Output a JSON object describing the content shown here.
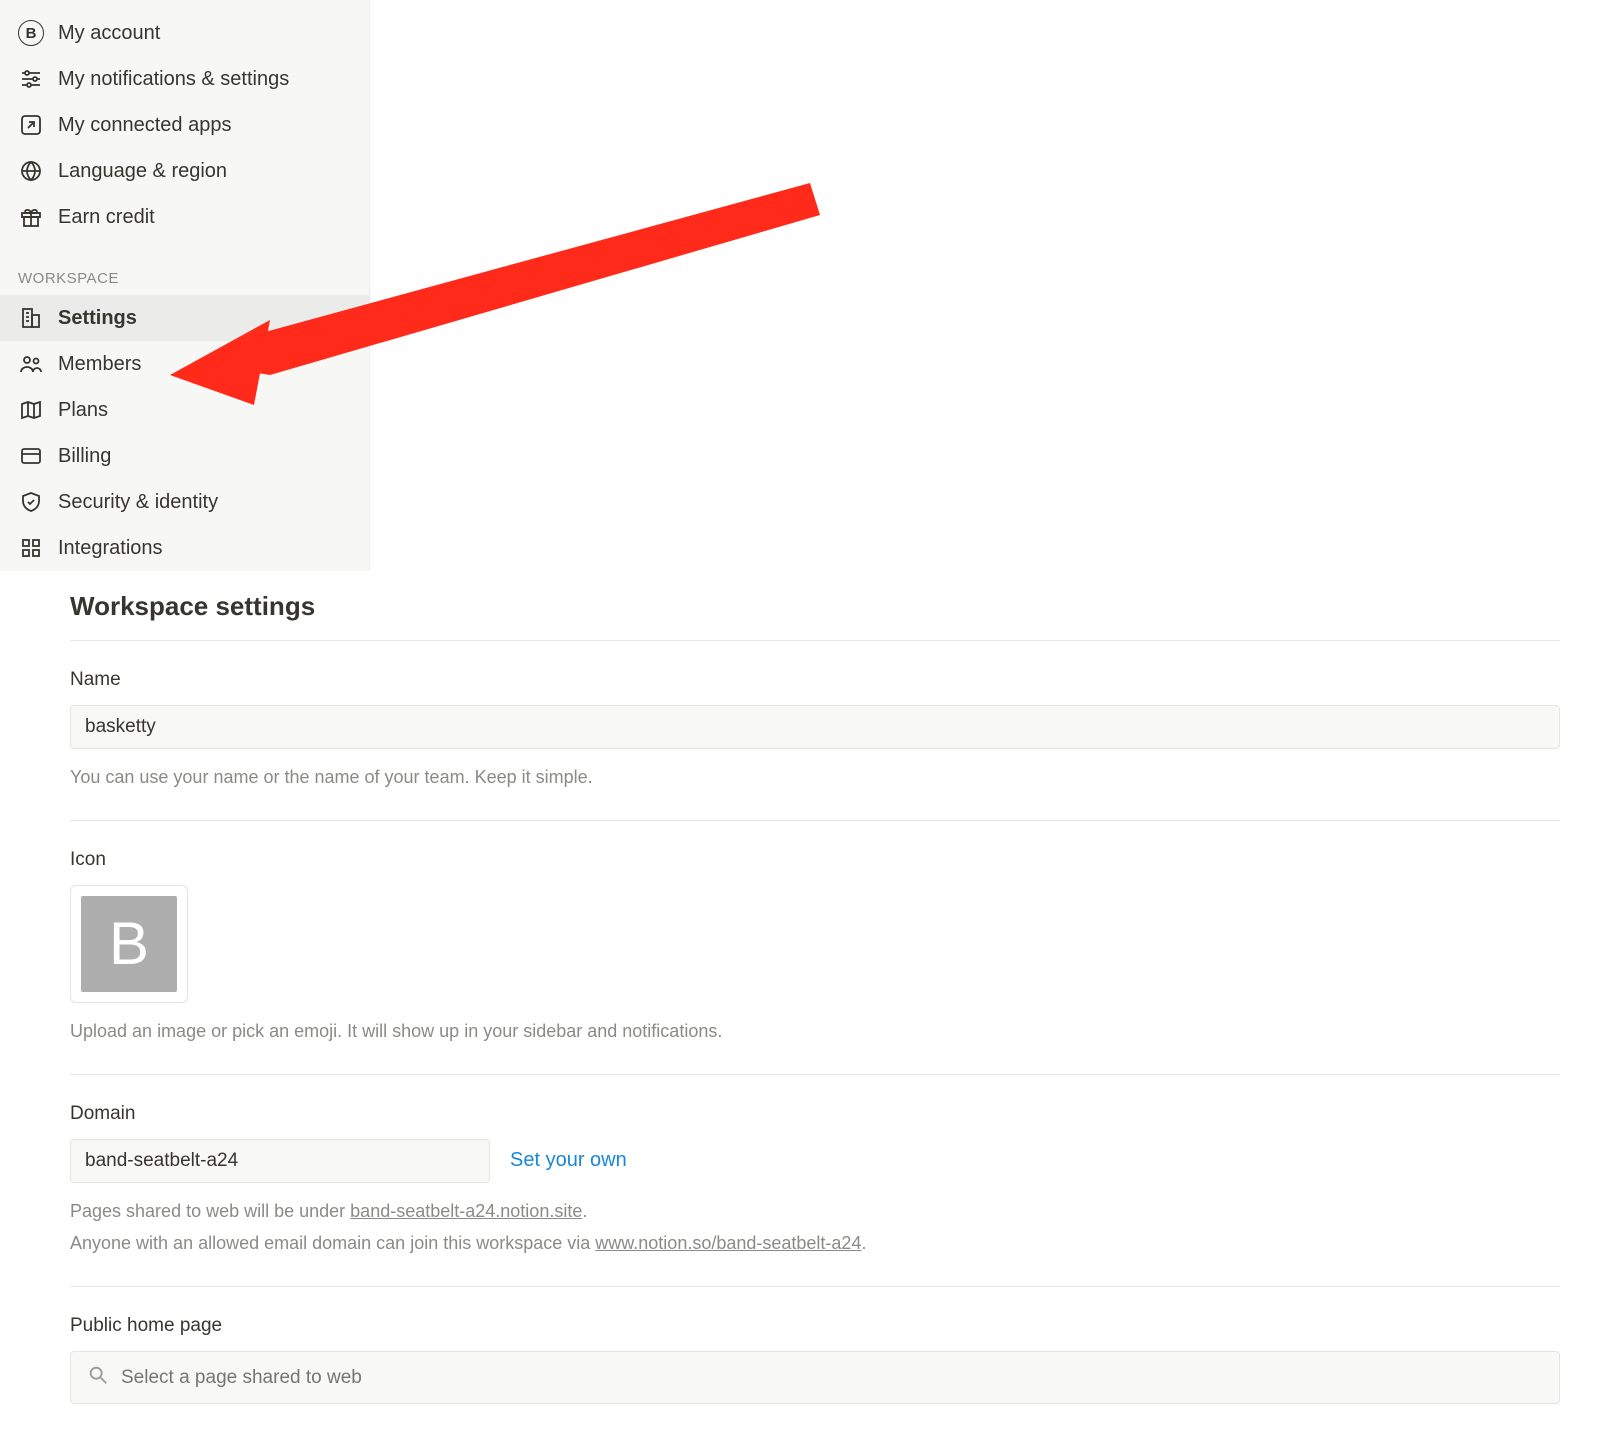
{
  "sidebar": {
    "account": [
      {
        "label": "My account",
        "icon": "circle-b"
      },
      {
        "label": "My notifications & settings",
        "icon": "sliders"
      },
      {
        "label": "My connected apps",
        "icon": "arrow-out"
      },
      {
        "label": "Language & region",
        "icon": "globe"
      },
      {
        "label": "Earn credit",
        "icon": "gift"
      }
    ],
    "workspace_label": "WORKSPACE",
    "workspace": [
      {
        "label": "Settings",
        "icon": "building",
        "selected": true
      },
      {
        "label": "Members",
        "icon": "people"
      },
      {
        "label": "Plans",
        "icon": "map"
      },
      {
        "label": "Billing",
        "icon": "card"
      },
      {
        "label": "Security & identity",
        "icon": "shield"
      },
      {
        "label": "Integrations",
        "icon": "grid"
      }
    ]
  },
  "page": {
    "title": "Workspace settings",
    "name": {
      "label": "Name",
      "value": "basketty",
      "helper": "You can use your name or the name of your team. Keep it simple."
    },
    "icon": {
      "label": "Icon",
      "letter": "B",
      "helper": "Upload an image or pick an emoji. It will show up in your sidebar and notifications."
    },
    "domain": {
      "label": "Domain",
      "value": "band-seatbelt-a24",
      "set_own": "Set your own",
      "helper1_pre": "Pages shared to web will be under ",
      "helper1_link": "band-seatbelt-a24.notion.site",
      "helper1_post": ".",
      "helper2_pre": "Anyone with an allowed email domain can join this workspace via ",
      "helper2_link": "www.notion.so/band-seatbelt-a24",
      "helper2_post": "."
    },
    "public_home": {
      "label": "Public home page",
      "placeholder": "Select a page shared to web"
    }
  }
}
